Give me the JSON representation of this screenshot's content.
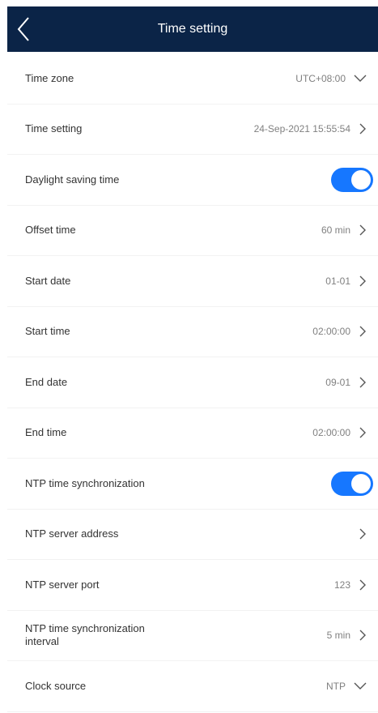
{
  "header": {
    "title": "Time setting",
    "back_icon": "back-arrow-icon"
  },
  "colors": {
    "header_bg": "#0b2447",
    "accent": "#1677ff",
    "value_text": "#808080"
  },
  "rows": [
    {
      "label": "Time zone",
      "value": "UTC+08:00",
      "control": "dropdown"
    },
    {
      "label": "Time setting",
      "value": "24-Sep-2021 15:55:54",
      "control": "chevron"
    },
    {
      "label": "Daylight saving time",
      "value": "",
      "control": "toggle",
      "on": true
    },
    {
      "label": "Offset time",
      "value": "60 min",
      "control": "chevron"
    },
    {
      "label": "Start date",
      "value": "01-01",
      "control": "chevron"
    },
    {
      "label": "Start time",
      "value": "02:00:00",
      "control": "chevron"
    },
    {
      "label": "End date",
      "value": "09-01",
      "control": "chevron"
    },
    {
      "label": "End time",
      "value": "02:00:00",
      "control": "chevron"
    },
    {
      "label": "NTP time synchronization",
      "value": "",
      "control": "toggle",
      "on": true
    },
    {
      "label": "NTP server address",
      "value": "",
      "control": "chevron"
    },
    {
      "label": "NTP server port",
      "value": "123",
      "control": "chevron"
    },
    {
      "label": "NTP time synchronization\ninterval",
      "value": "5 min",
      "control": "chevron"
    },
    {
      "label": "Clock source",
      "value": "NTP",
      "control": "dropdown"
    }
  ]
}
